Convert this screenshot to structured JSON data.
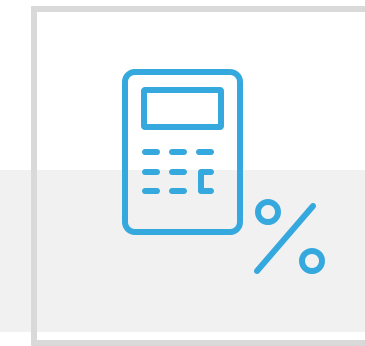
{
  "page": {
    "background": "#ffffff",
    "band_color": "#f1f1f1",
    "tile_border_color": "#d9d9d9"
  },
  "icon": {
    "name": "calculator-percent-icon",
    "stroke_color": "#35a8de"
  }
}
